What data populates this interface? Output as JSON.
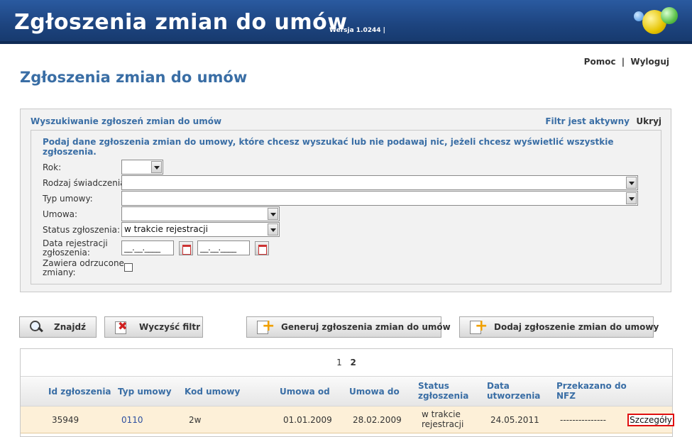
{
  "header": {
    "title": "Zgłoszenia zmian do umów",
    "version": "Wersja 1.0244 |"
  },
  "top_links": {
    "help": "Pomoc",
    "separator": "|",
    "logout": "Wyloguj"
  },
  "page_title": "Zgłoszenia zmian do umów",
  "filter": {
    "title": "Wyszukiwanie zgłoszeń zmian do umów",
    "status": "Filtr jest aktywny",
    "hide": "Ukryj",
    "hint": "Podaj dane zgłoszenia zmian do umowy, które chcesz wyszukać lub nie podawaj nic, jeżeli chcesz wyświetlić wszystkie zgłoszenia.",
    "fields": {
      "year_label": "Rok:",
      "year_value": "",
      "benefit_label": "Rodzaj świadczenia:",
      "benefit_value": "",
      "contract_type_label": "Typ umowy:",
      "contract_type_value": "",
      "contract_label": "Umowa:",
      "contract_value": "",
      "status_label": "Status zgłoszenia:",
      "status_value": "w trakcie rejestracji",
      "reg_date_label_1": "Data rejestracji",
      "reg_date_label_2": "zgłoszenia:",
      "date_from": "__.__.____",
      "date_to": "__.__.____",
      "rejected_label_1": "Zawiera odrzucone",
      "rejected_label_2": "zmiany:"
    }
  },
  "buttons": {
    "find": "Znajdź",
    "clear": "Wyczyść filtr",
    "generate": "Generuj zgłoszenia zmian do umów",
    "add": "Dodaj zgłoszenie zmian do umowy"
  },
  "pager": {
    "pages": [
      "1",
      "2"
    ],
    "current": "2"
  },
  "table": {
    "headers": {
      "id": "Id zgłoszenia",
      "type": "Typ umowy",
      "code": "Kod umowy",
      "from": "Umowa od",
      "to": "Umowa do",
      "status_1": "Status",
      "status_2": "zgłoszenia",
      "created_1": "Data",
      "created_2": "utworzenia",
      "nfz_1": "Przekazano do",
      "nfz_2": "NFZ"
    },
    "rows": [
      {
        "id": "35949",
        "type": "0110",
        "code": "2w",
        "from": "01.01.2009",
        "to": "28.02.2009",
        "status_1": "w trakcie",
        "status_2": "rejestracji",
        "created": "24.05.2011",
        "nfz": "---------------",
        "action": "Szczegóły"
      }
    ]
  }
}
